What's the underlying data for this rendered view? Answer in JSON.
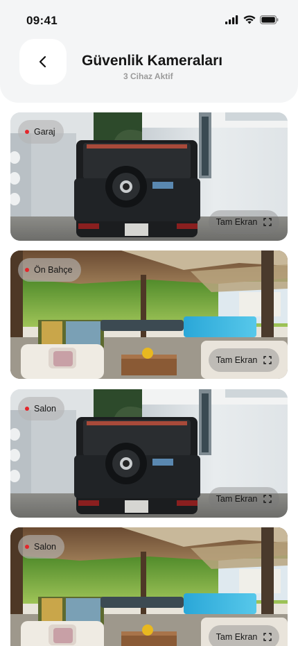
{
  "status_bar": {
    "time": "09:41"
  },
  "header": {
    "title": "Güvenlik Kameraları",
    "subtitle": "3 Cihaz Aktif"
  },
  "cameras": [
    {
      "name": "Garaj",
      "fullscreen_label": "Tam Ekran",
      "scene": "garage",
      "live_dot_color": "#e3262b"
    },
    {
      "name": "Ön Bahçe",
      "fullscreen_label": "Tam Ekran",
      "scene": "patio",
      "live_dot_color": "#e3262b"
    },
    {
      "name": "Salon",
      "fullscreen_label": "Tam Ekran",
      "scene": "garage",
      "live_dot_color": "#e3262b"
    },
    {
      "name": "Salon",
      "fullscreen_label": "Tam Ekran",
      "scene": "patio",
      "live_dot_color": "#e3262b"
    }
  ],
  "icons": [
    "back-arrow-icon",
    "signal-icon",
    "wifi-icon",
    "battery-icon",
    "expand-icon"
  ]
}
